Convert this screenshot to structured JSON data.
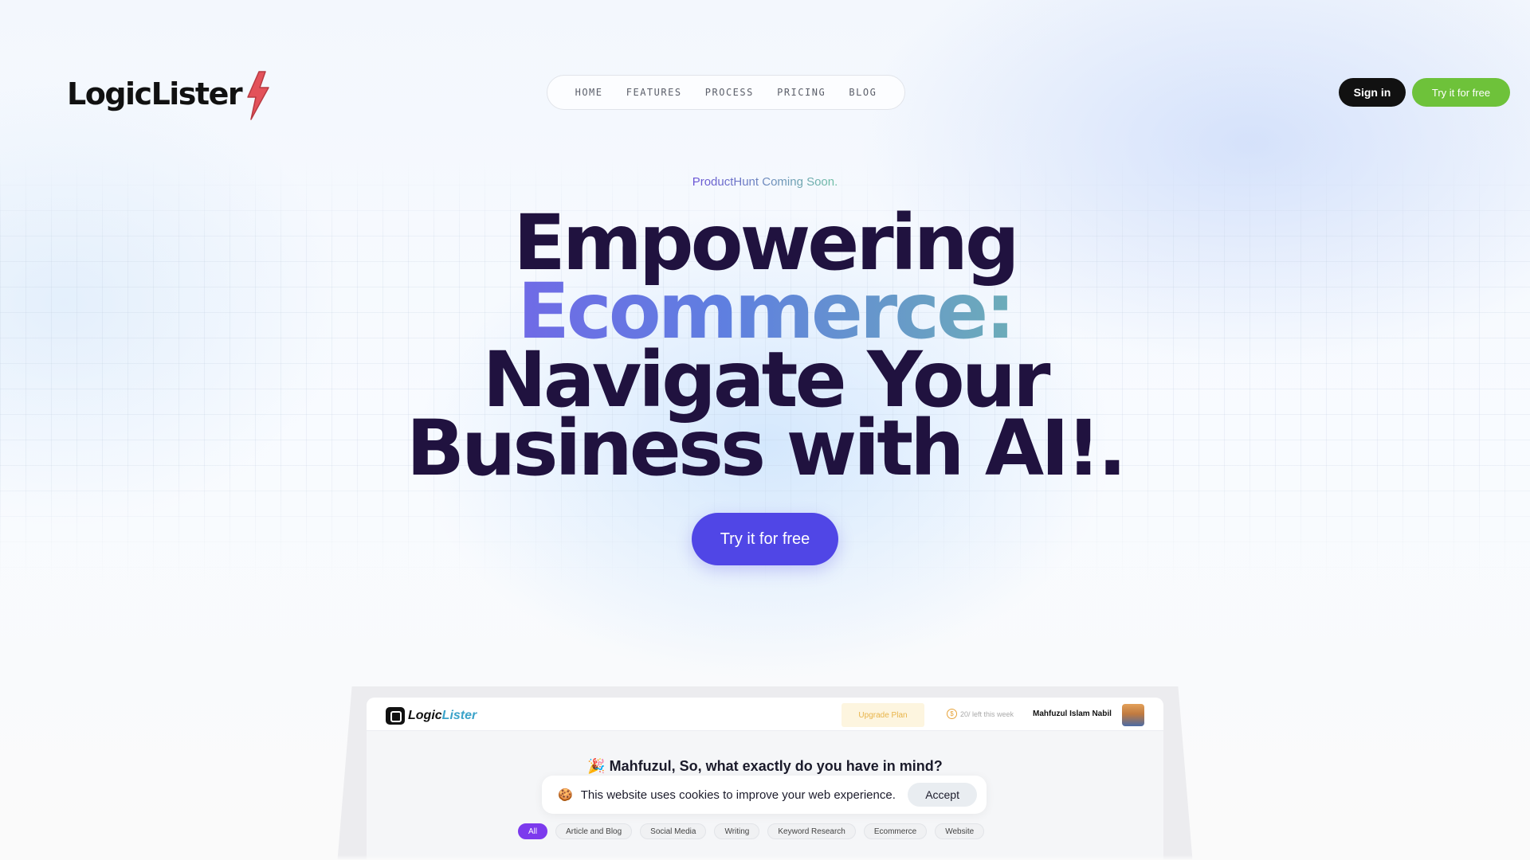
{
  "brand": {
    "name": "LogicLister",
    "accent_bolt": "#e3525a"
  },
  "nav": {
    "items": [
      "HOME",
      "FEATURES",
      "PROCESS",
      "PRICING",
      "BLOG"
    ]
  },
  "header": {
    "signin_label": "Sign in",
    "try_label": "Try it for free"
  },
  "hero": {
    "tagline": "ProductHunt Coming Soon.",
    "headline": {
      "line1": "Empowering",
      "line2": "Ecommerce:",
      "line3": "Navigate Your",
      "line4": "Business with AI!."
    },
    "cta_label": "Try it for free"
  },
  "mockup": {
    "logo_main": "Logic",
    "logo_accent": "Lister",
    "upgrade_label": "Upgrade Plan",
    "credits_text": "20/ left this week",
    "username": "Mahfuzul Islam Nabil",
    "prompt": "🎉 Mahfuzul, So, what exactly do you have in mind?",
    "chips": [
      "All",
      "Article and  Blog",
      "Social Media",
      "Writing",
      "Keyword Research",
      "Ecommerce",
      "Website"
    ]
  },
  "cookie": {
    "icon": "🍪",
    "message": "This website uses cookies to improve your web experience.",
    "accept_label": "Accept"
  },
  "colors": {
    "primary": "#5046e6",
    "green": "#6ec23a",
    "dark": "#111111",
    "headline": "#20123f",
    "chip_active": "#7c3aed"
  }
}
